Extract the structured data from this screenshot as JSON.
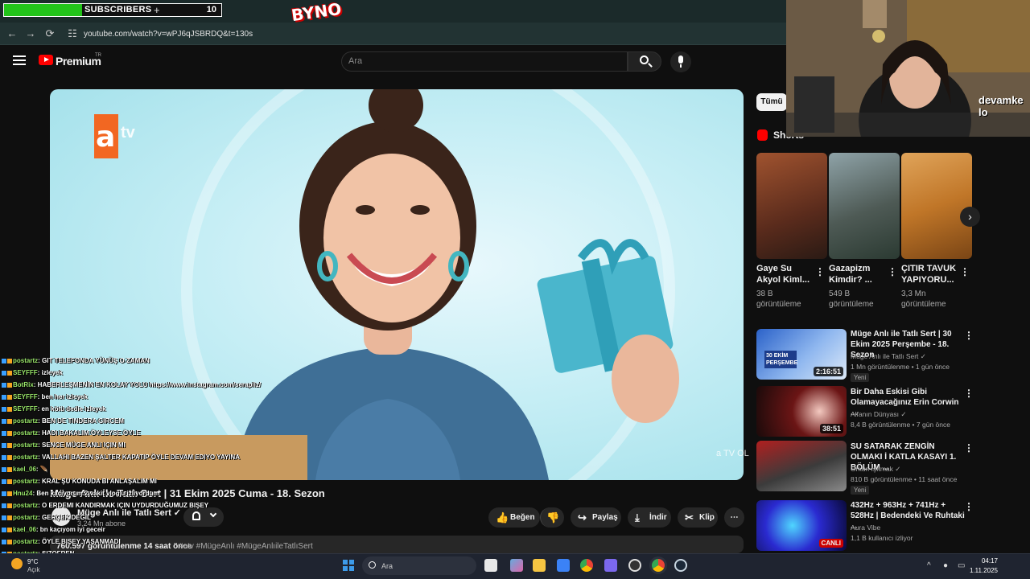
{
  "overlay": {
    "sub_label": "SUBSCRIBERS",
    "sub_plus": "+",
    "sub_count": "10",
    "sub_progress": 0.36,
    "logo_text": "BYNO",
    "cam_text": "devamke lo"
  },
  "browser": {
    "url": "youtube.com/watch?v=wPJ6qJSBRDQ&t=130s",
    "back_icon": "←",
    "forward_icon": "→",
    "reload_icon": "⟳",
    "site_icon": "☷"
  },
  "header": {
    "brand": "Premium",
    "region": "TR",
    "search_placeholder": "Ara"
  },
  "video": {
    "channel_logo_a": "a",
    "channel_logo_tv": "tv",
    "watermark": "a TV OL",
    "title": "Müge Anlı ile Tatlı Sert | 31 Ekim 2025 Cuma - 18. Sezon",
    "channel": "Müge Anlı ile Tatlı Sert ✓",
    "subscribers": "3,24 Mn abone",
    "views_time": "760.597 görüntülenme  14 saat önce",
    "tags": "#atv #MügeAnlı #MügeAnlıileTatlıSert",
    "actions": {
      "like": "Beğen",
      "share": "Paylaş",
      "download": "İndir",
      "clip": "Klip",
      "like_icon": "👍",
      "dislike_icon": "👎",
      "share_icon": "↪",
      "download_icon": "⤓",
      "clip_icon": "✂",
      "more_icon": "⋯"
    }
  },
  "chat": [
    {
      "user": "postartz",
      "msg": ": GIT TELEFONDA YÜNÜŞ O ZAMAN"
    },
    {
      "user": "SEYFFF",
      "msg": ": izleyek"
    },
    {
      "user": "BotRix",
      "msg": ": HABERLEŞMENİN EN KOLAY YOLU https://www.instagram.com/serapiiz/"
    },
    {
      "user": "SEYFFF",
      "msg": ": ben her izleyek"
    },
    {
      "user": "SEYFFF",
      "msg": ": en kötü dedie izleyek"
    },
    {
      "user": "postartz",
      "msg": ": BEN DE TINDERA GIRCEM"
    },
    {
      "user": "postartz",
      "msg": ": HADI BAKALIM ÖYLEYSE ÖYLE"
    },
    {
      "user": "postartz",
      "msg": ": SENCE MÜGE ANLI IÇIN MI"
    },
    {
      "user": "postartz",
      "msg": ": VALLAHI BAZEN ŞALTER KAPATIP ÖYLE DEVAM EDIYO YAYINA"
    },
    {
      "user": "kael_06",
      "msg": ": 🪶"
    },
    {
      "user": "postartz",
      "msg": ": KRAL ŞU KONUDA BI ANLAŞALIM MI"
    },
    {
      "user": "Hnu24",
      "msg": ": Ben kaçıyorum 2 vakit vlog'u izliyordum"
    },
    {
      "user": "postartz",
      "msg": ": O ERDEMI KANDIRMAK IÇIN UYDURDUĞUMUZ BIŞEY"
    },
    {
      "user": "postartz",
      "msg": ": GERÇEK DEĞIL"
    },
    {
      "user": "kael_06",
      "msg": ": bn kaçıyom iyi geceir"
    },
    {
      "user": "postartz",
      "msg": ": ÖYLE BIŞEY YAŞANMADI"
    },
    {
      "user": "postartz",
      "msg": ": SIZOFREN"
    }
  ],
  "sidebar": {
    "chip": "Tümü",
    "shorts_title": "Shorts",
    "shorts": [
      {
        "title": "Gaye Su Akyol Kiml...",
        "views": "38 B görüntüleme"
      },
      {
        "title": "Gazapizm Kimdir? ...",
        "views": "549 B görüntüleme"
      },
      {
        "title": "ÇITIR TAVUK YAPIYORU...",
        "views": "3,3 Mn görüntüleme"
      }
    ],
    "recs": [
      {
        "title": "Müge Anlı ile Tatlı Sert | 30 Ekim 2025 Perşembe - 18. Sezon",
        "channel": "Müge Anlı ile Tatlı Sert ✓",
        "meta": "1 Mn görüntülenme • 1 gün önce",
        "badge": "Yeni",
        "duration": "2:16:51",
        "thumb_text": "30 EKİM PERŞEMBE"
      },
      {
        "title": "Bir Daha Eskisi Gibi Olamayacağınız Erin Corwin ...",
        "channel": "Alfanın Dünyası ✓",
        "meta": "8,4 B görüntülenme • 7 gün önce",
        "duration": "38:51"
      },
      {
        "title": "SU SATARAK ZENGİN OLMAKI İ KATLA KASAYI 1. BÖLÜM ...",
        "channel": "Orkun Işıtmak ✓",
        "meta": "810 B görüntülenme • 11 saat önce",
        "badge": "Yeni"
      },
      {
        "title": "432Hz + 963Hz + 741Hz + 528Hz | Bedendeki Ve Ruhtaki ...",
        "channel": "Aura Vibe",
        "meta": "1,1 B kullanıcı izliyor",
        "live": "CANLI"
      }
    ]
  },
  "taskbar": {
    "weather_temp": "9°C",
    "weather_desc": "Açık",
    "search": "Ara",
    "time": "04:17",
    "date": "1.11.2025"
  },
  "colors": {
    "accent": "#ff0000",
    "bg": "#0f0f0f",
    "sub_bar": "#22c31a",
    "atv_orange": "#f26722"
  }
}
